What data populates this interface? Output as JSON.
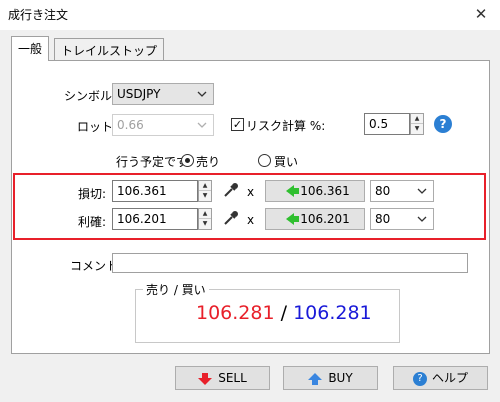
{
  "window": {
    "title": "成行き注文",
    "close_glyph": "✕"
  },
  "tabs": [
    {
      "label": "一般",
      "active": true
    },
    {
      "label": "トレイルストップ",
      "active": false
    }
  ],
  "symbol": {
    "label": "シンボル:",
    "value": "USDJPY"
  },
  "lot": {
    "label": "ロット:",
    "value": "0.66",
    "disabled": true
  },
  "risk": {
    "checkbox_label": "リスク計算 %:",
    "checked": true,
    "value": "0.5",
    "help_glyph": "?"
  },
  "order_type": {
    "label": "行う予定です",
    "sell_label": "売り",
    "buy_label": "買い",
    "selected": "sell"
  },
  "stop_loss": {
    "label": "損切:",
    "value": "106.361",
    "clear_glyph": "x",
    "price_button": "106.361",
    "points": "80"
  },
  "take_profit": {
    "label": "利確:",
    "value": "106.201",
    "clear_glyph": "x",
    "price_button": "106.201",
    "points": "80"
  },
  "comment": {
    "label": "コメント:",
    "value": ""
  },
  "prices": {
    "group_title": "売り / 買い",
    "bid": "106.281",
    "separator": "/",
    "ask": "106.281",
    "bid_color": "#e8202a",
    "ask_color": "#1a1ad8"
  },
  "buttons": {
    "sell": "SELL",
    "buy": "BUY",
    "help": "ヘルプ"
  }
}
